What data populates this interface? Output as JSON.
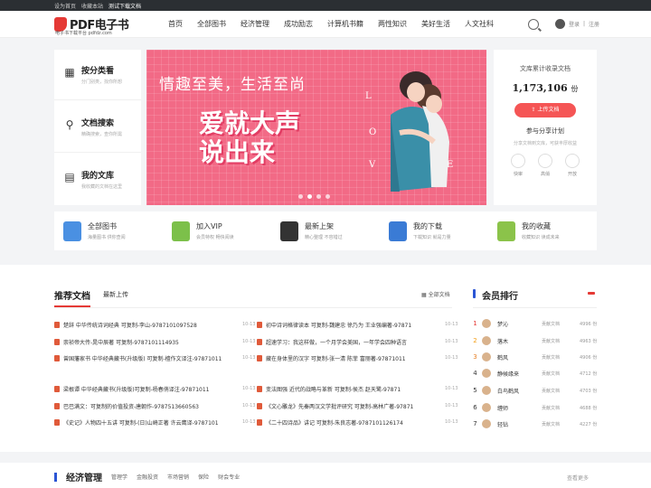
{
  "topbar": {
    "sethome": "设为首页",
    "bookmark": "收藏本站",
    "test": "测试下载文档"
  },
  "header": {
    "logo_text": "PDF电子书",
    "logo_sub": "电子书下载平台 pdfdz.com",
    "nav": [
      "首页",
      "全部图书",
      "经济管理",
      "成功励志",
      "计算机书籍",
      "两性知识",
      "美好生活",
      "人文社科"
    ],
    "login": "登录",
    "register": "注册"
  },
  "left_panel": [
    {
      "icon": "grid-icon",
      "title": "按分类看",
      "sub": "分门别类，找你所想"
    },
    {
      "icon": "search-icon",
      "title": "文档搜索",
      "sub": "精确搜索，查你所需"
    },
    {
      "icon": "library-icon",
      "title": "我的文库",
      "sub": "我收藏的文档在这里"
    }
  ],
  "banner": {
    "line1": "情趣至美，生活至尚",
    "line2a": "爱就大声",
    "line2b": "说出来",
    "letters": [
      "L",
      "O",
      "V",
      "E"
    ]
  },
  "right_panel": {
    "label": "文库累计收录文档",
    "count": "1,173,106",
    "unit": "份",
    "upload_btn": "上传文档",
    "plan_title": "参与分享计划",
    "plan_sub": "分享文档到文库，可获丰厚收益",
    "perks": [
      "快审",
      "高俏",
      "开放"
    ]
  },
  "features": [
    {
      "title": "全部图书",
      "sub": "海量图书 供你查阅",
      "color": "#4a90e2"
    },
    {
      "title": "加入VIP",
      "sub": "会员特权 畅快阅读",
      "color": "#7cc04a"
    },
    {
      "title": "最新上架",
      "sub": "精心整理 不容错过",
      "color": "#333333"
    },
    {
      "title": "我的下载",
      "sub": "下载知识 就是力量",
      "color": "#3a7bd5"
    },
    {
      "title": "我的收藏",
      "sub": "收藏知识 读成未来",
      "color": "#8bc34a"
    }
  ],
  "recommend": {
    "title": "推荐文档",
    "tab": "最新上传",
    "all": "全部文档",
    "left": [
      {
        "t": "楚辞 中华传统诗词经典 可复制-李山-9787101097528",
        "d": "10-13"
      },
      {
        "t": "崇祯帝大传-晁中辰著 可复制-9787101114935",
        "d": "10-13"
      },
      {
        "t": "曾国藩家书 中华经典藏书(升级版) 可复制-檀作文译注-97871011",
        "d": "10-13"
      },
      {
        "t": "梁根谭 中华经典藏书(升级版)可复制-杨春俏译注-97871011",
        "d": "10-13"
      },
      {
        "t": "巴巴满文：可复制的价值投资-唐朝作-9787513660563",
        "d": "10-13"
      },
      {
        "t": "《史记》人物四十五讲 可复制-(日)山崎正著 许云鹰译-9787101",
        "d": "10-13"
      }
    ],
    "right": [
      {
        "t": "初中诗词格律读本 可复制-魏建忠 徐乃为 王业强编著-97871",
        "d": "10-13"
      },
      {
        "t": "超速学习：我这样做，一个月学会美国，一年学会四种语言",
        "d": "10-13"
      },
      {
        "t": "藏在身体里的汉字 可复制-张一清 陈菲 富丽著-97871011",
        "d": "10-13"
      },
      {
        "t": "变法图强 近代的战略与革新 可复制-侯杰 赵天鹭-97871",
        "d": "10-13"
      },
      {
        "t": "《文心雕龙》先秦两汉文学批评研究 可复制-高林广著-97871",
        "d": "10-13"
      },
      {
        "t": "《二十四诗品》讲记 可复制-朱良志著-9787101126174",
        "d": "10-13"
      }
    ]
  },
  "ranking": {
    "title": "会员排行",
    "items": [
      {
        "n": "1",
        "name": "梦沁",
        "label": "贡献文档",
        "v": "4996 份"
      },
      {
        "n": "2",
        "name": "落木",
        "label": "贡献文档",
        "v": "4963 份"
      },
      {
        "n": "3",
        "name": "鹤风",
        "label": "贡献文档",
        "v": "4906 份"
      },
      {
        "n": "4",
        "name": "静候缘来",
        "label": "贡献文档",
        "v": "4712 份"
      },
      {
        "n": "5",
        "name": "白鸟鹤风",
        "label": "贡献文档",
        "v": "4703 份"
      },
      {
        "n": "6",
        "name": "缠师",
        "label": "贡献文档",
        "v": "4688 份"
      },
      {
        "n": "7",
        "name": "轻钻",
        "label": "贡献文档",
        "v": "4227 份"
      }
    ]
  },
  "economy": {
    "title": "经济管理",
    "tabs": [
      "管理学",
      "金融投资",
      "市场营销",
      "保险",
      "财会专业"
    ],
    "more": "查看更多"
  }
}
